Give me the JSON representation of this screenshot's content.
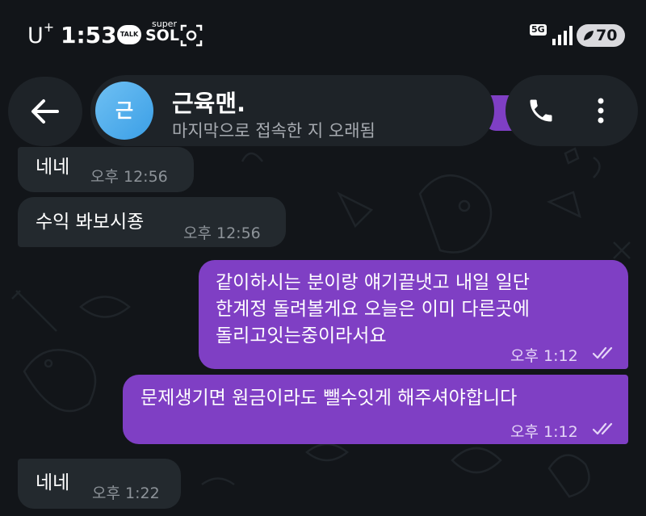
{
  "status_bar": {
    "carrier": "U",
    "carrier_sup": "+",
    "time": "1:53",
    "talk_badge": "TALK",
    "app_badge_top": "super",
    "app_badge_bottom": "SOL",
    "network": "5G",
    "battery": "70"
  },
  "header": {
    "avatar_initial": "근",
    "contact_name": "근육맨.",
    "last_seen": "마지막으로 접속한 지 오래됨"
  },
  "messages": [
    {
      "direction": "in",
      "text": "네네",
      "time": "오후 12:56"
    },
    {
      "direction": "in",
      "text": "수익 봐보시죵",
      "time": "오후 12:56"
    },
    {
      "direction": "out",
      "lines": [
        "같이하시는 분이랑 얘기끝냇고 내일 일단",
        "한계정 돌려볼게요 오늘은 이미 다른곳에",
        "돌리고잇는중이라서요"
      ],
      "time": "오후 1:12",
      "status": "read"
    },
    {
      "direction": "out",
      "text": "문제생기면 원금이라도 뺄수잇게 해주셔야합니다",
      "time": "오후 1:12",
      "status": "read"
    },
    {
      "direction": "in",
      "text": "네네",
      "time": "오후 1:22"
    }
  ],
  "colors": {
    "background": "#121519",
    "incoming_bubble": "#23292e",
    "outgoing_bubble": "#7f3fc4",
    "avatar": "#4aa9ec",
    "header_pill": "#1e2328"
  },
  "icons": {
    "back": "arrow-left-icon",
    "call": "phone-icon",
    "menu": "more-vertical-icon",
    "read": "double-check-icon"
  }
}
